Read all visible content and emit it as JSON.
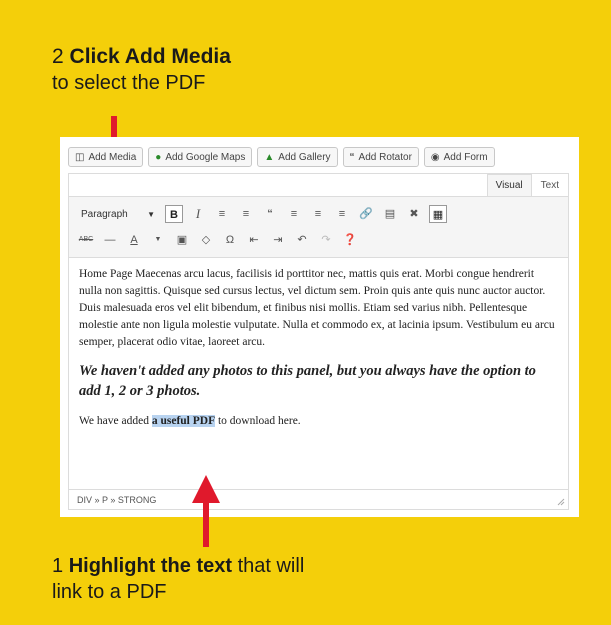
{
  "annotations": {
    "top": {
      "number": "2",
      "bold": "Click Add Media",
      "rest": "to select the PDF"
    },
    "bottom": {
      "number": "1",
      "bold": "Highlight the text",
      "after": " that will",
      "rest": "link to a PDF"
    }
  },
  "media_buttons": [
    {
      "label": "Add Media",
      "icon": "media-icon"
    },
    {
      "label": "Add Google Maps",
      "icon": "map-pin-icon"
    },
    {
      "label": "Add Gallery",
      "icon": "leaf-icon"
    },
    {
      "label": "Add Rotator",
      "icon": "quote-icon"
    },
    {
      "label": "Add Form",
      "icon": "form-icon"
    }
  ],
  "tabs": {
    "visual": "Visual",
    "text": "Text"
  },
  "toolbar": {
    "format_select": "Paragraph"
  },
  "content": {
    "p1": "Home Page Maecenas arcu lacus, facilisis id porttitor nec, mattis quis erat. Morbi congue hendrerit nulla non sagittis. Quisque sed cursus lectus, vel dictum sem. Proin quis ante quis nunc auctor auctor. Duis malesuada eros vel elit bibendum, et finibus nisi mollis. Etiam sed varius nibh. Pellentesque molestie ante non ligula molestie vulputate. Nulla et commodo ex, at lacinia ipsum. Vestibulum eu arcu semper, placerat odio vitae, laoreet arcu.",
    "p2": "We haven't added any photos to this panel, but you always have the option to add 1, 2 or 3 photos.",
    "p3_before": "We have added ",
    "p3_highlight": "a useful PDF",
    "p3_after": " to download here."
  },
  "statusbar": {
    "path": "DIV » P » STRONG"
  },
  "colors": {
    "background": "#f4cf0a",
    "arrow": "#e0192c",
    "highlight": "#b8d3f0"
  }
}
